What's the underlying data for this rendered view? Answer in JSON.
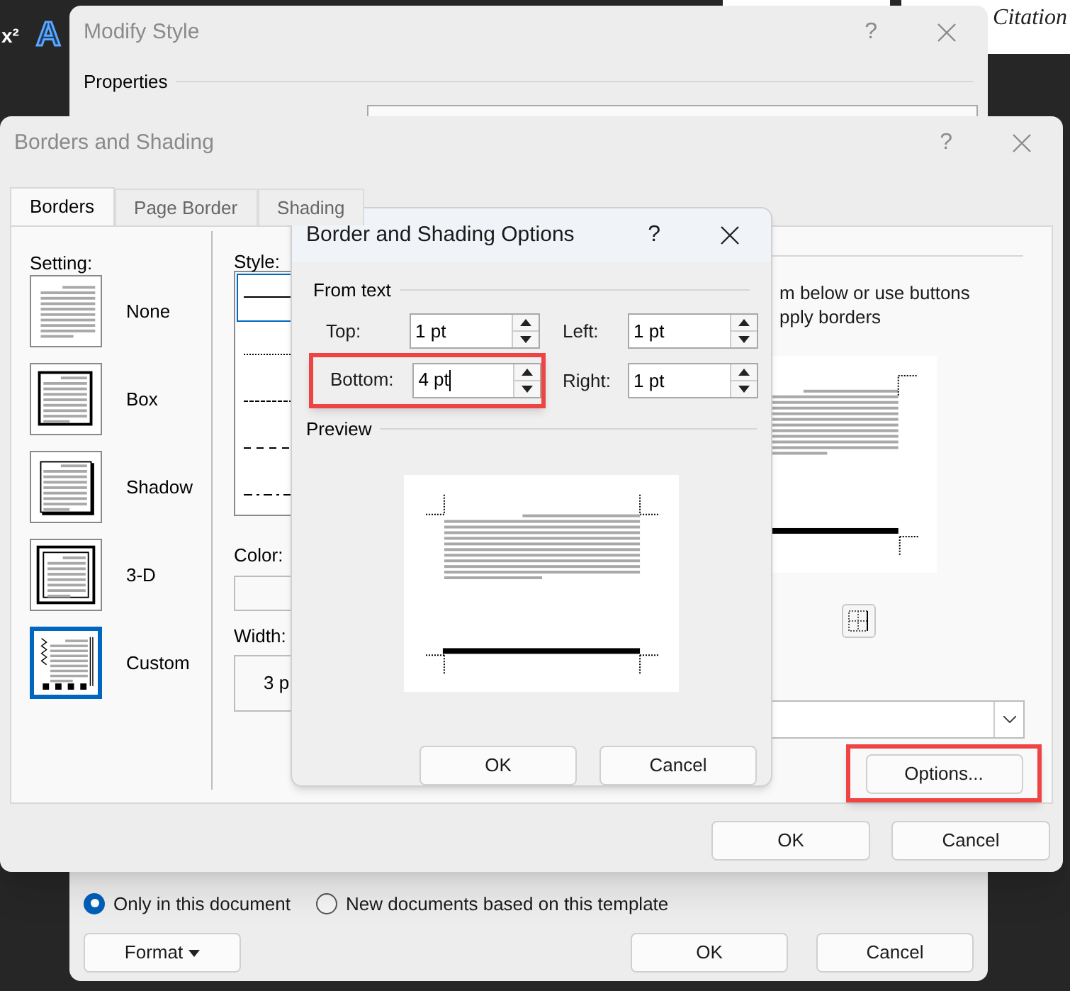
{
  "ribbon": {
    "items": [
      {
        "kind": "superscript",
        "text": "x²"
      },
      {
        "kind": "text-effect",
        "text": "A"
      }
    ],
    "citation": "Citation"
  },
  "modify_style": {
    "title": "Modify Style",
    "help": "?",
    "section": "Properties",
    "radios": [
      {
        "label": "Only in this document",
        "selected": true
      },
      {
        "label": "New documents based on this template",
        "selected": false
      }
    ],
    "format_button": "Format",
    "buttons": [
      "OK",
      "Cancel"
    ]
  },
  "borders_dialog": {
    "title": "Borders and Shading",
    "help": "?",
    "tabs": [
      {
        "label": "Borders",
        "selected": true
      },
      {
        "label": "Page Border",
        "selected": false
      },
      {
        "label": "Shading",
        "selected": false
      }
    ],
    "setting_label": "Setting:",
    "settings": [
      {
        "kind": "none",
        "label": "None",
        "selected": false
      },
      {
        "kind": "box",
        "label": "Box",
        "selected": false
      },
      {
        "kind": "shadow",
        "label": "Shadow",
        "selected": false
      },
      {
        "kind": "threed",
        "label": "3-D",
        "selected": false
      },
      {
        "kind": "custom",
        "label": "Custom",
        "selected": true
      }
    ],
    "style_label": "Style:",
    "styles": [
      {
        "kind": "solid",
        "selected": true
      },
      {
        "kind": "dotted",
        "selected": false
      },
      {
        "kind": "dashed",
        "selected": false
      },
      {
        "kind": "dash-wide",
        "selected": false
      },
      {
        "kind": "dash-dot",
        "selected": false
      }
    ],
    "color_label": "Color:",
    "width_label": "Width:",
    "width_value": "3 p",
    "instructions": [
      "m below or use buttons",
      "pply borders"
    ],
    "options_button": {
      "label": "Options...",
      "highlighted": true
    },
    "buttons": [
      "OK",
      "Cancel"
    ]
  },
  "options_dialog": {
    "title": "Border and Shading Options",
    "help": "?",
    "from_text_label": "From text",
    "fields": [
      {
        "label": "Top:",
        "value": "1 pt",
        "highlighted": false,
        "focused": false
      },
      {
        "label": "Left:",
        "value": "1 pt",
        "highlighted": false,
        "focused": false
      },
      {
        "label": "Bottom:",
        "value": "4 pt",
        "highlighted": true,
        "focused": true
      },
      {
        "label": "Right:",
        "value": "1 pt",
        "highlighted": false,
        "focused": false
      }
    ],
    "preview_label": "Preview",
    "buttons": [
      "OK",
      "Cancel"
    ]
  }
}
